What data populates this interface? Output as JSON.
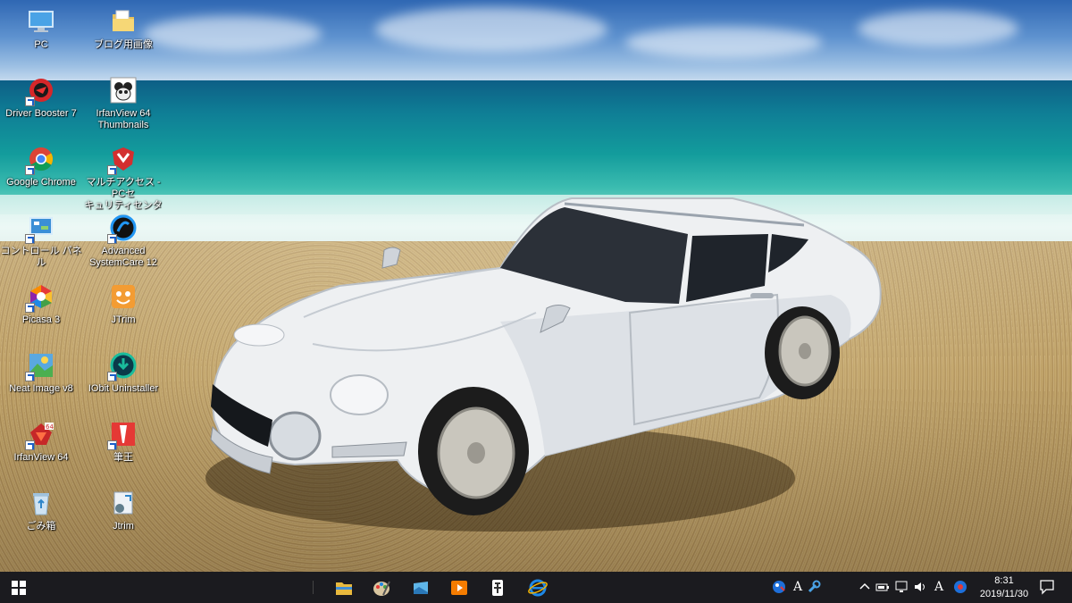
{
  "desktop": {
    "icons": [
      {
        "label": "PC"
      },
      {
        "label": "ブログ用画像"
      },
      {
        "label": "Driver Booster 7"
      },
      {
        "label": "IrfanView 64\nThumbnails"
      },
      {
        "label": "Google Chrome"
      },
      {
        "label": "マルチアクセス - PCセ\nキュリティセンター"
      },
      {
        "label": "コントロール パネル"
      },
      {
        "label": "Advanced\nSystemCare 12"
      },
      {
        "label": "Picasa 3"
      },
      {
        "label": "JTrim"
      },
      {
        "label": "Neat Image v8"
      },
      {
        "label": "IObit Uninstaller"
      },
      {
        "label": "IrfanView 64"
      },
      {
        "label": "筆王"
      },
      {
        "label": "ごみ箱"
      },
      {
        "label": "Jtrim"
      }
    ]
  },
  "taskbar": {
    "clock": {
      "time": "8:31",
      "date": "2019/11/30"
    },
    "ime_indicator": "A",
    "ime_indicator_tray": "A"
  },
  "colors": {
    "taskbar_bg": "#1b1b1f",
    "start_icon": "#ffffff",
    "car_body": "#eef0f2"
  }
}
